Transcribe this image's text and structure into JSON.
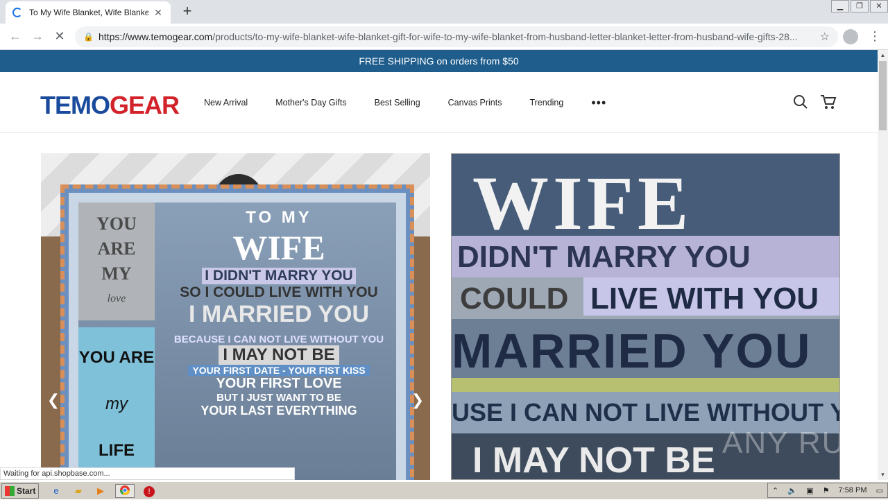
{
  "browser": {
    "tab_title": "To My Wife Blanket, Wife Blanket, Gi",
    "url_domain": "https://www.temogear.com",
    "url_path": "/products/to-my-wife-blanket-wife-blanket-gift-for-wife-to-my-wife-blanket-from-husband-letter-blanket-letter-from-husband-wife-gifts-28...",
    "status_text": "Waiting for api.shopbase.com..."
  },
  "announcement": "FREE SHIPPING on orders from $50",
  "logo": {
    "part1": "TEMO",
    "part2": "GEAR"
  },
  "nav": [
    "New Arrival",
    "Mother's Day Gifts",
    "Best Selling",
    "Canvas Prints",
    "Trending"
  ],
  "gallery_left": {
    "col1_top": [
      "YOU",
      "ARE",
      "MY",
      "love"
    ],
    "col1_bottom": [
      "YOU ARE",
      "my",
      "LIFE"
    ],
    "lines": [
      "TO MY",
      "WIFE",
      "I DIDN'T MARRY YOU",
      "SO I COULD  LIVE WITH YOU",
      "I MARRIED YOU",
      "BECAUSE I CAN NOT LIVE WITHOUT YOU",
      "I MAY NOT BE",
      "YOUR FIRST DATE - YOUR FIST KISS",
      "YOUR FIRST LOVE",
      "BUT I JUST WANT   TO BE",
      "YOUR LAST EVERYTHING"
    ]
  },
  "main_image": {
    "lines": [
      "WIFE",
      "DIDN'T MARRY YOU",
      "COULD",
      "LIVE WITH YOU",
      "MARRIED YOU",
      "USE I CAN NOT LIVE WITHOUT YOU",
      "I MAY NOT BE"
    ]
  },
  "watermark": "ANY RUN",
  "taskbar": {
    "start": "Start",
    "time": "7:58 PM"
  }
}
